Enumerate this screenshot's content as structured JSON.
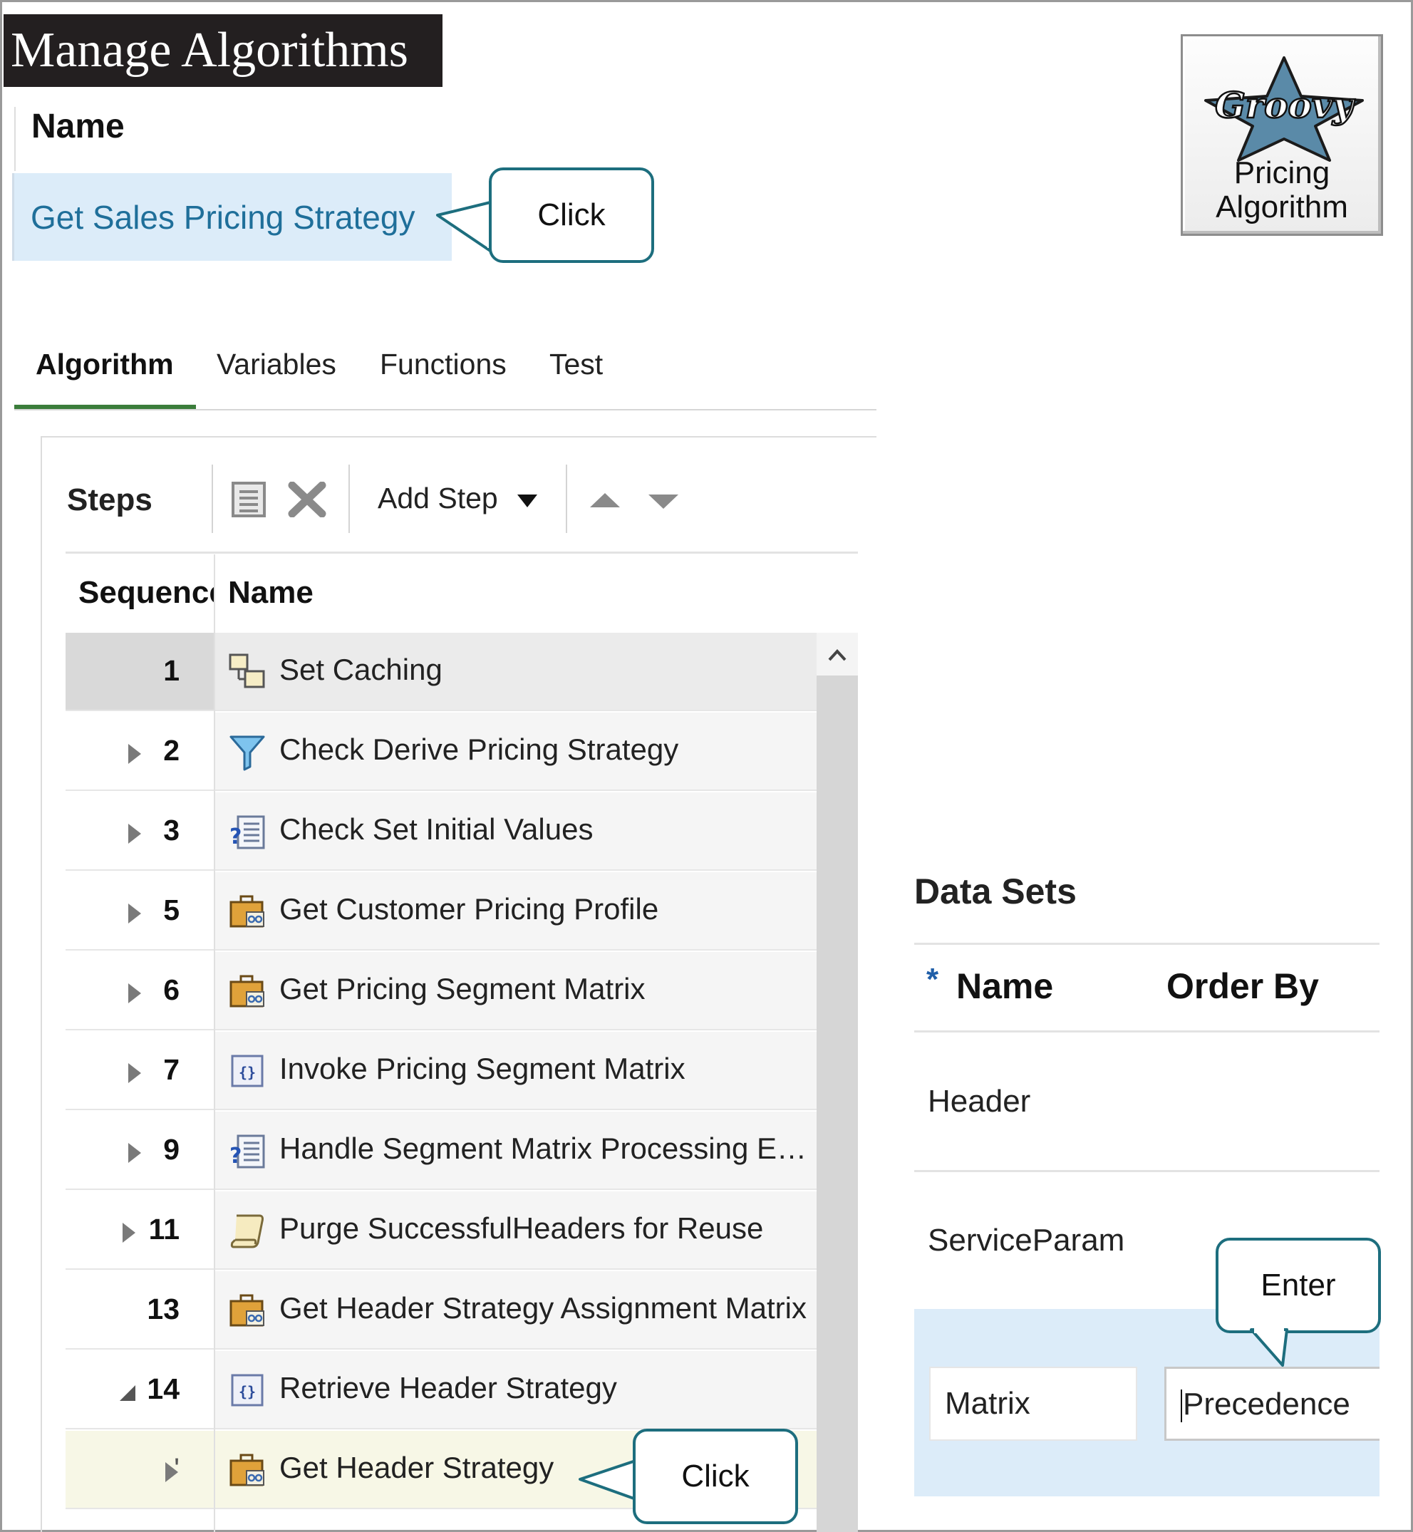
{
  "page": {
    "title": "Manage Algorithms",
    "name_column": "Name",
    "selected_algorithm": "Get Sales Pricing Strategy"
  },
  "callouts": {
    "top_click": "Click",
    "bottom_click": "Click",
    "enter": "Enter"
  },
  "badge": {
    "logo_text": "Groovy",
    "line1": "Pricing",
    "line2": "Algorithm"
  },
  "tabs": [
    {
      "label": "Algorithm",
      "active": true
    },
    {
      "label": "Variables",
      "active": false
    },
    {
      "label": "Functions",
      "active": false
    },
    {
      "label": "Test",
      "active": false
    }
  ],
  "steps": {
    "title": "Steps",
    "add_step_label": "Add Step",
    "columns": {
      "sequence": "Sequence",
      "name": "Name"
    },
    "rows": [
      {
        "seq": "1",
        "name": "Set Caching",
        "icon": "multi-window-icon",
        "expander": "none",
        "state": "selected"
      },
      {
        "seq": "2",
        "name": "Check Derive Pricing Strategy",
        "icon": "filter-icon",
        "expander": "collapsed"
      },
      {
        "seq": "3",
        "name": "Check Set Initial Values",
        "icon": "conditional-list-icon",
        "expander": "collapsed"
      },
      {
        "seq": "5",
        "name": "Get Customer Pricing Profile",
        "icon": "briefcase-icon",
        "expander": "collapsed"
      },
      {
        "seq": "6",
        "name": "Get Pricing Segment Matrix",
        "icon": "briefcase-icon",
        "expander": "collapsed"
      },
      {
        "seq": "7",
        "name": "Invoke Pricing Segment Matrix",
        "icon": "code-block-icon",
        "expander": "collapsed"
      },
      {
        "seq": "9",
        "name": "Handle Segment Matrix Processing E…",
        "icon": "conditional-list-icon",
        "expander": "collapsed"
      },
      {
        "seq": "11",
        "name": "Purge SuccessfulHeaders for Reuse",
        "icon": "scroll-icon",
        "expander": "collapsed"
      },
      {
        "seq": "13",
        "name": "Get Header Strategy Assignment Matrix",
        "icon": "briefcase-icon",
        "expander": "none"
      },
      {
        "seq": "14",
        "name": "Retrieve Header Strategy",
        "icon": "code-block-icon",
        "expander": "expanded"
      },
      {
        "seq": "'",
        "name": "Get Header Strategy",
        "icon": "briefcase-icon",
        "expander": "collapsed",
        "state": "highlighted"
      }
    ]
  },
  "data_sets": {
    "title": "Data Sets",
    "required_marker": "*",
    "columns": {
      "name": "Name",
      "order_by": "Order By"
    },
    "rows": [
      {
        "name": "Header",
        "order_by": ""
      },
      {
        "name": "ServiceParam",
        "order_by": ""
      },
      {
        "name": "Matrix",
        "order_by": "Precedence"
      }
    ]
  },
  "colors": {
    "title_bar": "#231f20",
    "selection": "#dcecf9",
    "link": "#1f6f9a",
    "callout_border": "#1d6e7e",
    "tab_underline": "#3b7d3b",
    "highlight_row": "#f7f7e6",
    "groovy_star": "#5a8aa8"
  }
}
